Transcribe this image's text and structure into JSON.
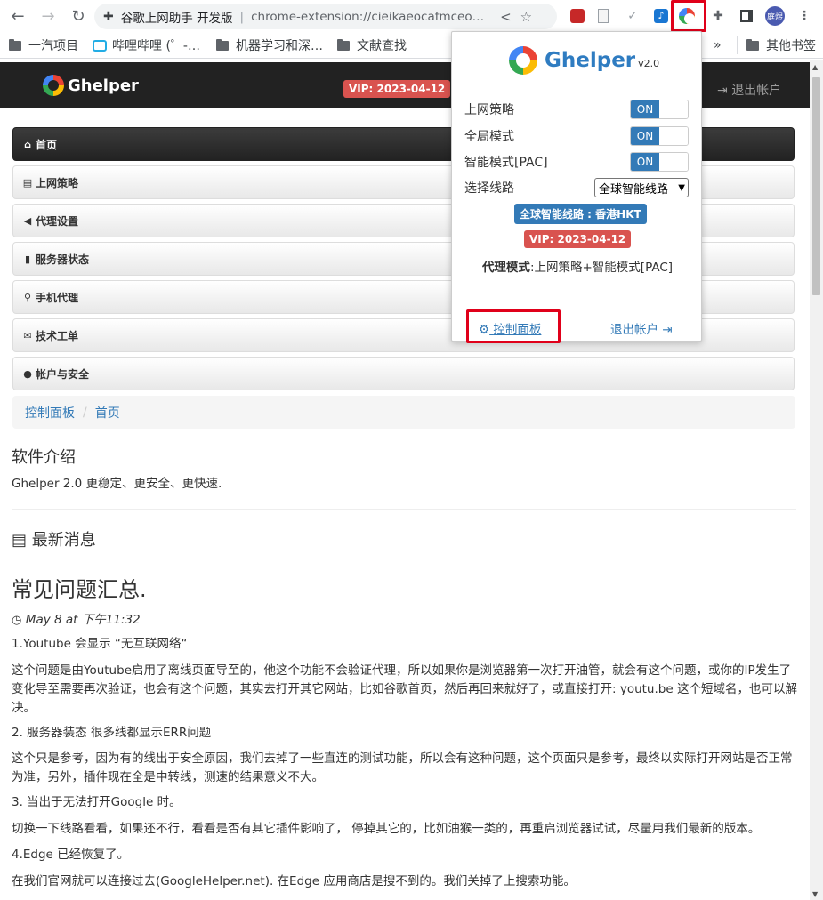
{
  "browser": {
    "tab_title": "谷歌上网助手 开发版",
    "url": "chrome-extension://cieikaeocafmceoapf...",
    "avatar_text": "庭煜",
    "bookmarks": [
      "一汽项目",
      "哔哩哔哩 (゜-…",
      "机器学习和深…",
      "文献查找"
    ],
    "bookmarks_more": "»",
    "other_bookmarks": "其他书签"
  },
  "navbar": {
    "brand": "Ghelper",
    "vip_badge": "VIP: 2023-04-12",
    "logout": "退出帐户"
  },
  "menu": [
    {
      "icon": "⌂",
      "label": "首页",
      "active": true
    },
    {
      "icon": "▤",
      "label": "上网策略"
    },
    {
      "icon": "◀",
      "label": "代理设置"
    },
    {
      "icon": "▮",
      "label": "服务器状态"
    },
    {
      "icon": "⚲",
      "label": "手机代理"
    },
    {
      "icon": "✉",
      "label": "技术工单"
    },
    {
      "icon": "●",
      "label": "帐户与安全"
    }
  ],
  "breadcrumb": [
    "控制面板",
    "首页"
  ],
  "intro": {
    "heading": "软件介绍",
    "text": "Ghelper 2.0 更稳定、更安全、更快速."
  },
  "news": {
    "heading": "最新消息",
    "post_title": "常见问题汇总.",
    "post_date": "May 8 at 下午11:32",
    "paragraphs": [
      "1.Youtube 会显示 “无互联网络“",
      "这个问题是由Youtube启用了离线页面导至的，他这个功能不会验证代理，所以如果你是浏览器第一次打开油管，就会有这个问题，或你的IP发生了变化导至需要再次验证，也会有这个问题，其实去打开其它网站，比如谷歌首页，然后再回来就好了，或直接打开: youtu.be 这个短域名，也可以解决。",
      "2. 服务器装态 很多线都显示ERR问题",
      "这个只是参考，因为有的线出于安全原因，我们去掉了一些直连的测试功能，所以会有这种问题，这个页面只是参考，最终以实际打开网站是否正常为准，另外，插件现在全是中转线，测速的结果意义不大。",
      "3. 当出于无法打开Google 时。",
      "切换一下线路看看，如果还不行，看看是否有其它插件影响了， 停掉其它的，比如油猴一类的，再重启浏览器试试，尽量用我们最新的版本。",
      "4.Edge 已经恢复了。",
      "在我们官网就可以连接过去(GoogleHelper.net). 在Edge 应用商店是搜不到的。我们关掉了上搜索功能。"
    ]
  },
  "popup": {
    "brand": "Ghelper",
    "version": "v2.0",
    "rows": [
      {
        "label": "上网策略",
        "state": "ON"
      },
      {
        "label": "全局模式",
        "state": "ON"
      },
      {
        "label": "智能模式[PAC]",
        "state": "ON"
      }
    ],
    "route_label": "选择线路",
    "route_value": "全球智能线路",
    "route_badge": "全球智能线路 : 香港HKT",
    "vip_badge": "VIP: 2023-04-12",
    "mode_label": "代理模式",
    "mode_value": ":上网策略+智能模式[PAC]",
    "control_panel": "控制面板",
    "logout": "退出帐户"
  }
}
